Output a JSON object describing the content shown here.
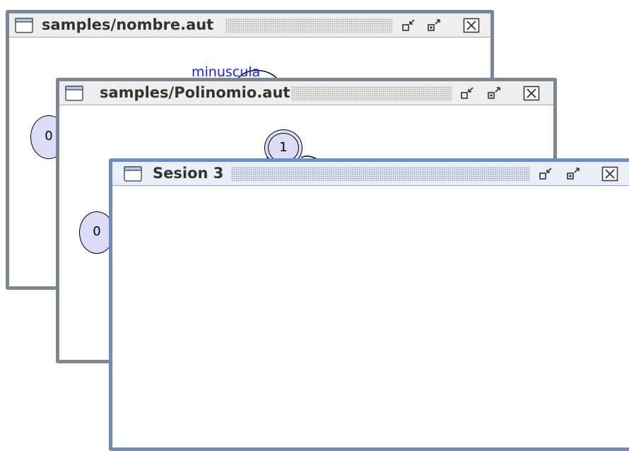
{
  "windows": [
    {
      "title": "samples/nombre.aut",
      "graph": {
        "states": [
          "0"
        ],
        "transition_label": "minuscula"
      }
    },
    {
      "title": "samples/Polinomio.aut",
      "graph": {
        "states": [
          "0",
          "1"
        ]
      }
    },
    {
      "title": "Sesion 3",
      "active": true
    }
  ],
  "icons": {
    "frame": "window-frame-icon",
    "minimize": "minimize-icon",
    "maximize": "maximize-icon",
    "close": "close-icon"
  }
}
